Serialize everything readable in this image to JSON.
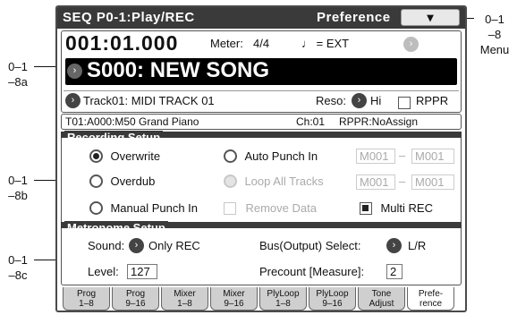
{
  "callouts": {
    "menu_a": "0–1",
    "menu_b": "–8",
    "menu_c": "Menu",
    "a_a": "0–1",
    "a_b": "–8a",
    "b_a": "0–1",
    "b_b": "–8b",
    "c_a": "0–1",
    "c_b": "–8c"
  },
  "header": {
    "title": "SEQ P0-1:Play/REC",
    "page": "Preference",
    "menu_glyph": "▾"
  },
  "locate": {
    "position": "001:01.000",
    "meter_label": "Meter:",
    "meter_value": "4/4",
    "tempo": "♩ = EXT"
  },
  "song": {
    "name": "S000: NEW SONG"
  },
  "track": {
    "name": "Track01: MIDI TRACK 01",
    "reso_label": "Reso:",
    "reso_value": "Hi",
    "rppr_label": "RPPR"
  },
  "info": {
    "track_prog": "T01:A000:M50 Grand Piano",
    "ch": "Ch:01",
    "rppr": "RPPR:NoAssign"
  },
  "recording": {
    "title": "Recording Setup",
    "overwrite": "Overwrite",
    "overdub": "Overdub",
    "manual_punch": "Manual Punch In",
    "auto_punch": "Auto Punch In",
    "loop_all": "Loop All Tracks",
    "remove_data": "Remove Data",
    "multi_rec": "Multi REC",
    "punch_from": "M001",
    "punch_to": "M001",
    "loop_from": "M001",
    "loop_to": "M001",
    "dash": "–"
  },
  "metronome": {
    "title": "Metronome Setup",
    "sound_label": "Sound:",
    "sound_value": "Only REC",
    "bus_label": "Bus(Output) Select:",
    "bus_value": "L/R",
    "level_label": "Level:",
    "level_value": "127",
    "precount_label": "Precount [Measure]:",
    "precount_value": "2"
  },
  "tabs": [
    {
      "l1": "Prog",
      "l2": "1–8"
    },
    {
      "l1": "Prog",
      "l2": "9–16"
    },
    {
      "l1": "Mixer",
      "l2": "1–8"
    },
    {
      "l1": "Mixer",
      "l2": "9–16"
    },
    {
      "l1": "PlyLoop",
      "l2": "1–8"
    },
    {
      "l1": "PlyLoop",
      "l2": "9–16"
    },
    {
      "l1": "Tone",
      "l2": "Adjust"
    },
    {
      "l1": "Prefe-",
      "l2": "rence"
    }
  ]
}
